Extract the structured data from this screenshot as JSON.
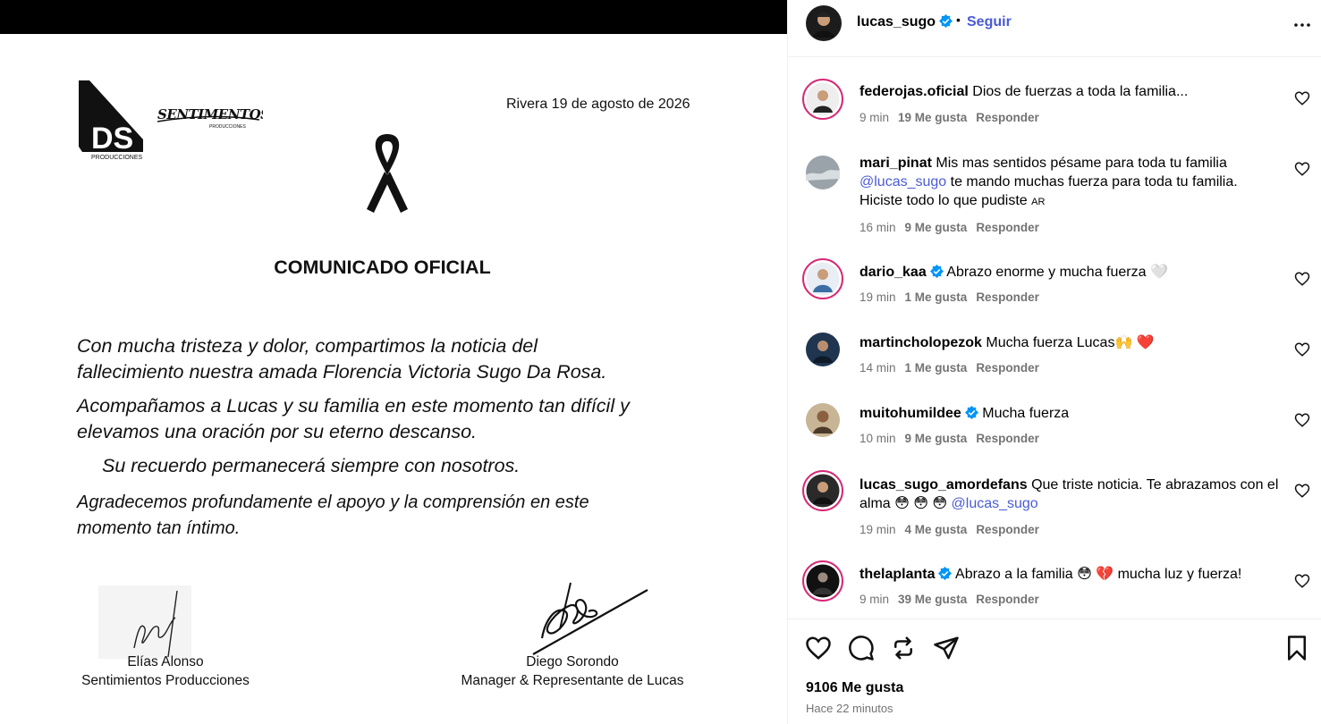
{
  "document": {
    "logo_left_text": "DS",
    "logo_left_sub": "PRODUCCIONES",
    "logo_right_text": "SENTIMENTOS",
    "logo_right_sub": "PRODUCCIONES",
    "date": "Rivera 19 de agosto de 2026",
    "title": "COMUNICADO OFICIAL",
    "p1_line1": "Con mucha tristeza y dolor, compartimos la noticia del",
    "p1_line2": "fallecimiento nuestra amada Florencia Victoria Sugo Da Rosa.",
    "p2_line1": "Acompañamos a Lucas y su familia en este momento tan difícil y",
    "p2_line2": "elevamos una oración por su eterno descanso.",
    "p3": "Su recuerdo permanecerá siempre con nosotros.",
    "p4_line1": "Agradecemos profundamente el apoyo y la comprensión en este",
    "p4_line2": "momento tan íntimo.",
    "signer1_name": "Elías Alonso",
    "signer1_org": "Sentimientos Producciones",
    "signer2_name": "Diego Sorondo",
    "signer2_role": "Manager & Representante de Lucas"
  },
  "header": {
    "username": "lucas_sugo",
    "separator": "•",
    "follow_label": "Seguir",
    "more_label": "..."
  },
  "comments": [
    {
      "user": "federojas.oficial",
      "text": "Dios de fuerzas a toda la familia...",
      "time": "9 min",
      "likes": "19 Me gusta",
      "reply": "Responder",
      "verified": false
    },
    {
      "user": "mari_pinat",
      "text_a": "Mis mas sentidos pésame para toda tu familia",
      "mention": "@lucas_sugo",
      "text_b": "te mando muchas fuerza para toda tu familia.",
      "text_c": "Hiciste todo lo que pudiste",
      "flag": "AR",
      "time": "16 min",
      "likes": "9 Me gusta",
      "reply": "Responder",
      "verified": false
    },
    {
      "user": "dario_kaa",
      "text": "Abrazo enorme y mucha fuerza 🤍",
      "time": "19 min",
      "likes": "1 Me gusta",
      "reply": "Responder",
      "verified": true
    },
    {
      "user": "martincholopezok",
      "text": "Mucha fuerza Lucas🙌 ❤️",
      "time": "14 min",
      "likes": "1 Me gusta",
      "reply": "Responder",
      "verified": false
    },
    {
      "user": "muitohumildee",
      "text": "Mucha fuerza",
      "time": "10 min",
      "likes": "9 Me gusta",
      "reply": "Responder",
      "verified": true
    },
    {
      "user": "lucas_sugo_amordefans",
      "text_a": "Que triste noticia. Te abrazamos con el alma 😳 😳 😳",
      "mention": "@lucas_sugo",
      "time": "19 min",
      "likes": "4 Me gusta",
      "reply": "Responder",
      "verified": false
    },
    {
      "user": "thelaplanta",
      "text": "Abrazo a la familia 😳 💔 mucha luz y fuerza!",
      "time": "9 min",
      "likes": "39 Me gusta",
      "reply": "Responder",
      "verified": true
    }
  ],
  "footer": {
    "likes_total": "9106 Me gusta",
    "time_ago": "Hace 22 minutos"
  },
  "colors": {
    "link": "#4a5bd4",
    "verified": "#0095f6",
    "muted": "#737373",
    "heart_red": "#ff3040"
  },
  "icons": [
    "black-ribbon-icon",
    "verified-badge-icon",
    "heart-icon",
    "comment-icon",
    "repost-icon",
    "share-icon",
    "bookmark-icon",
    "more-options-icon"
  ]
}
